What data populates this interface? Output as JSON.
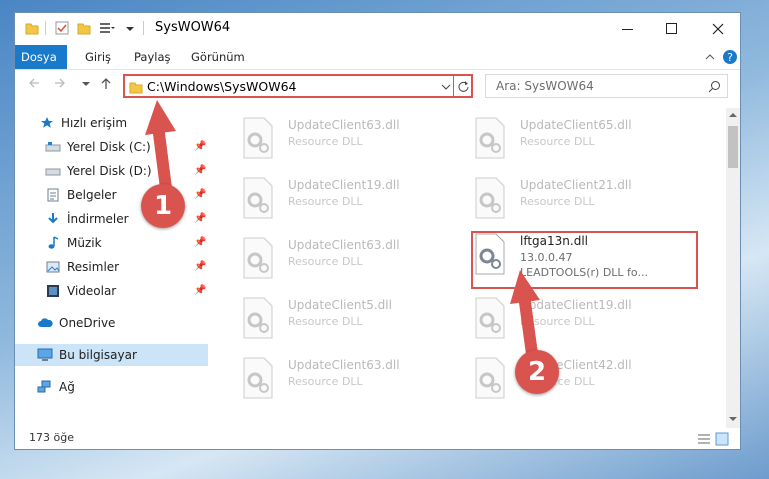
{
  "window": {
    "title": "SysWOW64",
    "ribbon_tabs": [
      "Dosya",
      "Giriş",
      "Paylaş",
      "Görünüm"
    ]
  },
  "address": {
    "path": "C:\\Windows\\SysWOW64",
    "search_placeholder": "Ara: SysWOW64"
  },
  "sidebar": {
    "quick_access": "Hızlı erişim",
    "items": [
      {
        "label": "Yerel Disk (C:)",
        "icon": "drive-icon"
      },
      {
        "label": "Yerel Disk (D:)",
        "icon": "drive-icon"
      },
      {
        "label": "Belgeler",
        "icon": "documents-icon"
      },
      {
        "label": "İndirmeler",
        "icon": "downloads-icon"
      },
      {
        "label": "Müzik",
        "icon": "music-icon"
      },
      {
        "label": "Resimler",
        "icon": "pictures-icon"
      },
      {
        "label": "Videolar",
        "icon": "videos-icon"
      }
    ],
    "onedrive": "OneDrive",
    "this_pc": "Bu bilgisayar",
    "network": "Ağ"
  },
  "files": [
    {
      "name": "UpdateClient63.dll",
      "desc": "Resource DLL"
    },
    {
      "name": "UpdateClient65.dll",
      "desc": "Resource DLL"
    },
    {
      "name": "UpdateClient19.dll",
      "desc": "Resource DLL"
    },
    {
      "name": "UpdateClient21.dll",
      "desc": "Resource DLL"
    },
    {
      "name": "UpdateClient63.dll",
      "desc": "Resource DLL"
    },
    {
      "name": "lftga13n.dll",
      "version": "13.0.0.47",
      "desc": "LEADTOOLS(r) DLL fo..."
    },
    {
      "name": "UpdateClient5.dll",
      "desc": "Resource DLL"
    },
    {
      "name": "UpdateClient19.dll",
      "desc": "Resource DLL"
    },
    {
      "name": "UpdateClient63.dll",
      "desc": "Resource DLL"
    },
    {
      "name": "UpdateClient42.dll",
      "desc": "Resource DLL"
    }
  ],
  "status": {
    "item_count": "173 öğe"
  },
  "badges": {
    "one": "1",
    "two": "2"
  },
  "colors": {
    "accent": "#1979ca",
    "highlight": "#d9534f"
  }
}
